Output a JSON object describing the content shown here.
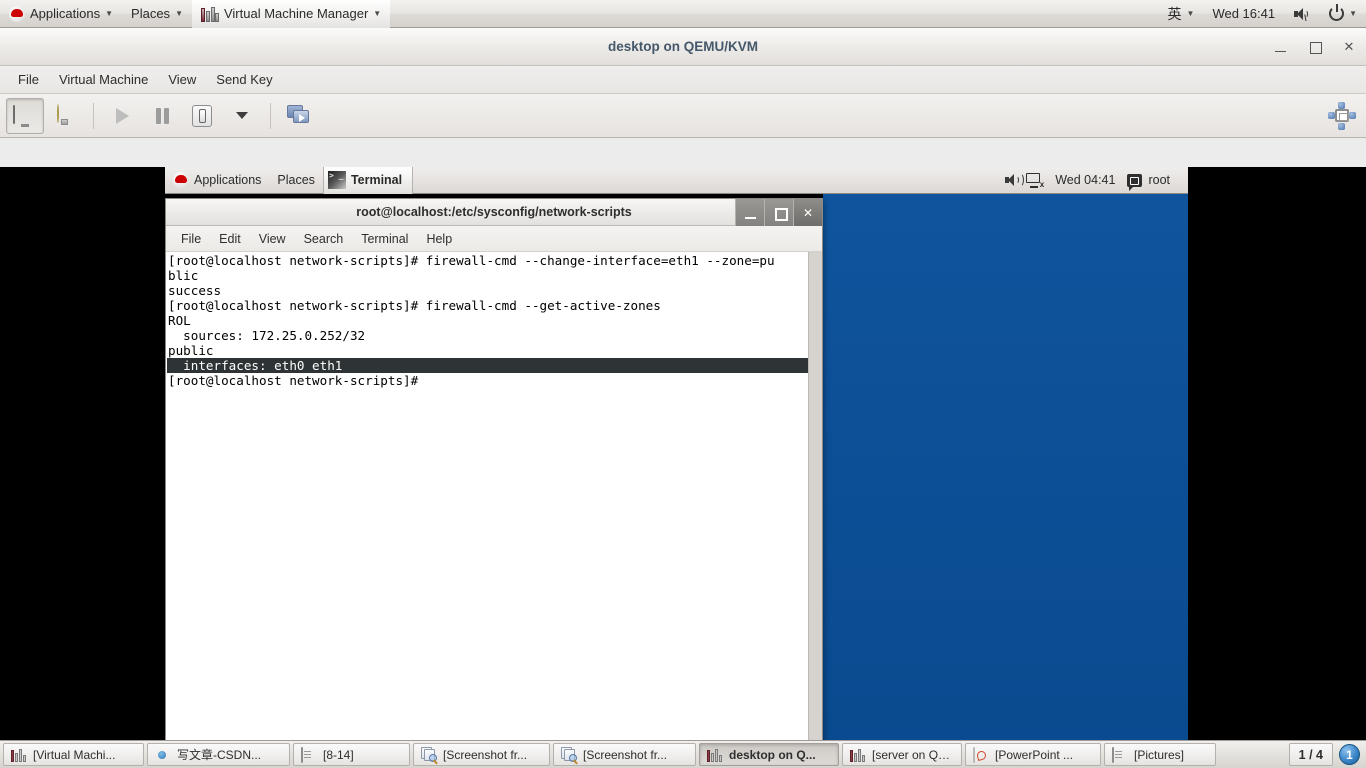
{
  "host_panel": {
    "logo_icon": "redhat-logo-icon",
    "items": [
      {
        "label": "Applications",
        "caret": "▼"
      },
      {
        "label": "Places",
        "caret": "▼"
      },
      {
        "label": "Virtual Machine Manager",
        "caret": "▼",
        "icon": "vmm-icon"
      }
    ],
    "ime": "英",
    "ime_caret": "▼",
    "clock": "Wed 16:41",
    "volume_icon": "volume-muted-icon",
    "power_icon": "power-icon",
    "power_caret": "▼"
  },
  "vmm_window": {
    "title": "desktop on QEMU/KVM",
    "window_buttons": {
      "minimize": "–",
      "maximize": "□",
      "close": "✕"
    },
    "menus": [
      "File",
      "Virtual Machine",
      "View",
      "Send Key"
    ],
    "toolbar": [
      {
        "name": "show-console-button",
        "icon": "monitor-icon",
        "pressed": true
      },
      {
        "name": "show-details-button",
        "icon": "lightbulb-icon",
        "pressed": false
      },
      {
        "name": "run-button",
        "icon": "play-icon",
        "pressed": false
      },
      {
        "name": "pause-button",
        "icon": "pause-icon",
        "pressed": false
      },
      {
        "name": "shutdown-button",
        "icon": "shutdown-icon",
        "pressed": false
      },
      {
        "name": "shutdown-menu-button",
        "icon": "chevron-down-icon",
        "pressed": false
      },
      {
        "name": "snapshots-button",
        "icon": "snapshots-icon",
        "pressed": false
      }
    ],
    "resize_icon": "resize-to-vm-icon"
  },
  "guest": {
    "panel": {
      "logo_icon": "redhat-logo-icon",
      "menus": [
        "Applications",
        "Places"
      ],
      "window_task": {
        "label": "Terminal",
        "icon": "terminal-icon"
      },
      "volume_icon": "volume-icon",
      "network_icon": "network-disconnected-icon",
      "clock": "Wed 04:41",
      "user_icon": "user-status-icon",
      "user": "root"
    },
    "desktop_color": "#0f549d"
  },
  "terminal": {
    "title": "root@localhost:/etc/sysconfig/network-scripts",
    "window_buttons": {
      "minimize": "_",
      "maximize": "□",
      "close": "✕"
    },
    "menus": [
      "File",
      "Edit",
      "View",
      "Search",
      "Terminal",
      "Help"
    ],
    "lines": [
      {
        "text": "[root@localhost network-scripts]# firewall-cmd --change-interface=eth1 --zone=pu",
        "selected": false
      },
      {
        "text": "blic",
        "selected": false
      },
      {
        "text": "success",
        "selected": false
      },
      {
        "text": "[root@localhost network-scripts]# firewall-cmd --get-active-zones",
        "selected": false
      },
      {
        "text": "ROL",
        "selected": false
      },
      {
        "text": "  sources: 172.25.0.252/32",
        "selected": false
      },
      {
        "text": "public",
        "selected": false
      },
      {
        "text": "  interfaces: eth0 eth1",
        "selected": true
      },
      {
        "text": "[root@localhost network-scripts]#",
        "selected": false
      }
    ],
    "selection_bg": "#2e3436",
    "selection_fg": "#ffffff"
  },
  "taskbar": {
    "tasks": [
      {
        "label": "[Virtual Machi...",
        "icon": "vmm-icon",
        "active": false
      },
      {
        "label": "写文章-CSDN...",
        "icon": "firefox-icon",
        "active": false
      },
      {
        "label": "[8-14]",
        "icon": "files-icon",
        "active": false
      },
      {
        "label": "[Screenshot fr...",
        "icon": "screenshot-icon",
        "active": false
      },
      {
        "label": "[Screenshot fr...",
        "icon": "screenshot-icon",
        "active": false
      },
      {
        "label": "desktop on Q...",
        "icon": "vmm-icon",
        "active": true
      },
      {
        "label": "[server on QE...",
        "icon": "vmm-icon",
        "active": false
      },
      {
        "label": "[PowerPoint ...",
        "icon": "powerpoint-icon",
        "active": false
      },
      {
        "label": "[Pictures]",
        "icon": "files-icon",
        "active": false
      }
    ],
    "page_count": "1 / 4",
    "workspace_badge": "1"
  }
}
